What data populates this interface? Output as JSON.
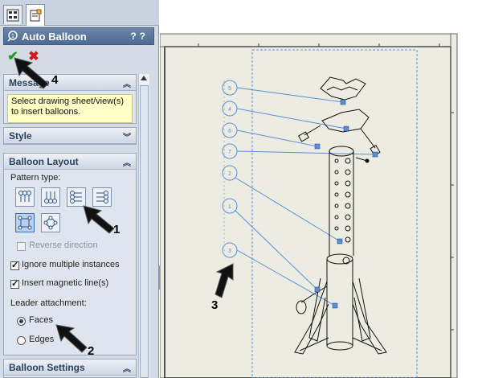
{
  "tabs": [
    {
      "name": "feature-manager-tab-icon"
    },
    {
      "name": "property-manager-tab-icon"
    }
  ],
  "property_manager": {
    "title": "Auto Balloon",
    "help_label": "?",
    "ok_icon": "checkmark-icon",
    "cancel_icon": "x-icon"
  },
  "message_group": {
    "title": "Message",
    "text": "Select drawing sheet/view(s) to insert balloons."
  },
  "style_group": {
    "title": "Style"
  },
  "balloon_layout": {
    "title": "Balloon Layout",
    "pattern_type_label": "Pattern type:",
    "reverse_direction": {
      "label": "Reverse direction",
      "checked": false,
      "enabled": false
    },
    "ignore_multiple": {
      "label": "Ignore multiple instances",
      "checked": true
    },
    "insert_magnetic": {
      "label": "Insert magnetic line(s)",
      "checked": true
    },
    "leader_attachment_label": "Leader attachment:",
    "leader_options": [
      {
        "label": "Faces",
        "selected": true
      },
      {
        "label": "Edges",
        "selected": false
      }
    ]
  },
  "balloon_settings": {
    "title": "Balloon Settings"
  },
  "callouts": [
    "1",
    "2",
    "3",
    "4"
  ],
  "balloons": [
    "5",
    "4",
    "6",
    "7",
    "2",
    "1",
    "3"
  ],
  "colors": {
    "accent": "#4b6a94",
    "sheet_bg": "#ecece2",
    "balloon": "#5a8fd6",
    "selected": "#b9d0ee"
  }
}
